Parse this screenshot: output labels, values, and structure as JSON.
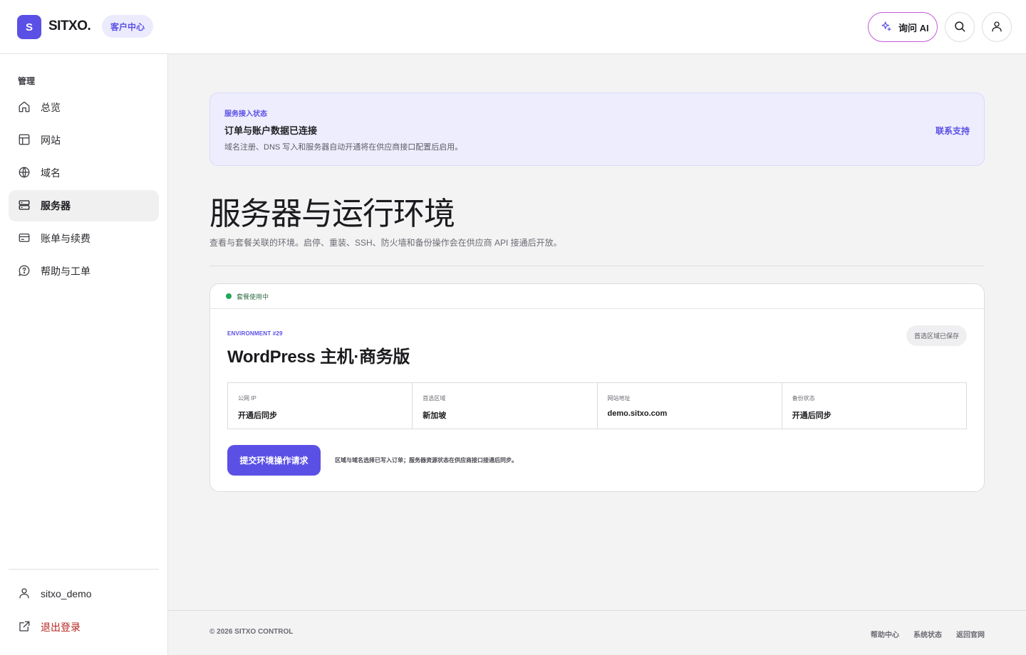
{
  "header": {
    "logo_letter": "S",
    "brand": "SITXO.",
    "center_pill": "客户中心",
    "ai_button": "询问 AI"
  },
  "sidebar": {
    "section_title": "管理",
    "items": [
      {
        "label": "总览",
        "icon": "home-icon"
      },
      {
        "label": "网站",
        "icon": "layout-icon"
      },
      {
        "label": "域名",
        "icon": "globe-icon"
      },
      {
        "label": "服务器",
        "icon": "server-icon",
        "active": true
      },
      {
        "label": "账单与续费",
        "icon": "credit-card-icon"
      },
      {
        "label": "帮助与工单",
        "icon": "help-icon"
      }
    ],
    "username": "sitxo_demo",
    "logout": "退出登录"
  },
  "banner": {
    "kicker": "服务接入状态",
    "title": "订单与账户数据已连接",
    "desc": "域名注册、DNS 写入和服务器自动开通将在供应商接口配置后启用。",
    "link": "联系支持"
  },
  "page": {
    "title": "服务器与运行环境",
    "subtitle": "查看与套餐关联的环境。启停、重装、SSH、防火墙和备份操作会在供应商 API 接通后开放。"
  },
  "environment": {
    "status": "套餐使用中",
    "kicker": "ENVIRONMENT #29",
    "title": "WordPress 主机·商务版",
    "region_badge": "首选区域已保存",
    "info": [
      {
        "label": "公网 IP",
        "value": "开通后同步"
      },
      {
        "label": "首选区域",
        "value": "新加坡"
      },
      {
        "label": "网站地址",
        "value": "demo.sitxo.com"
      },
      {
        "label": "备份状态",
        "value": "开通后同步"
      }
    ],
    "submit_button": "提交环境操作请求",
    "note": "区域与域名选择已写入订单；服务器资源状态在供应商接口接通后同步。"
  },
  "footer": {
    "copyright": "© 2026 SITXO CONTROL",
    "links": [
      "帮助中心",
      "系统状态",
      "返回官网"
    ]
  },
  "colors": {
    "accent": "#5b50e6",
    "status_green": "#22a65a",
    "logout_red": "#b3261e"
  }
}
